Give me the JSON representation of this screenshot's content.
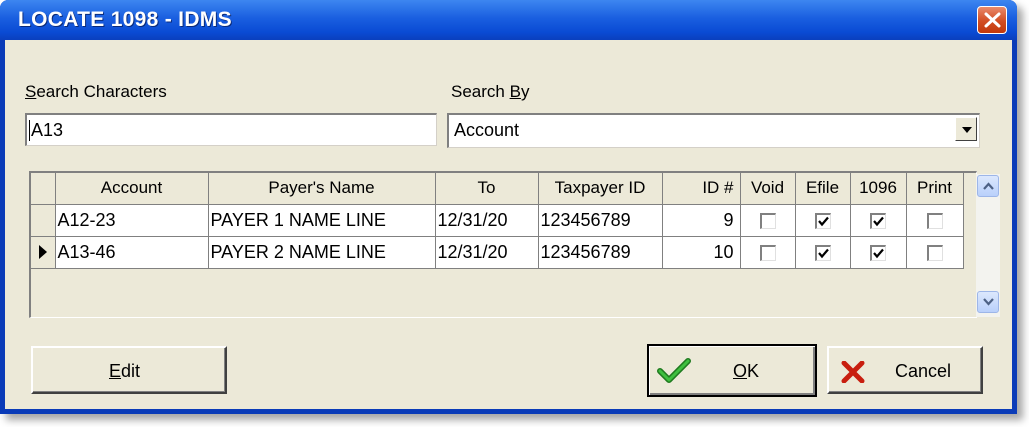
{
  "window": {
    "title": "LOCATE 1098 - IDMS"
  },
  "search": {
    "characters_label_key": "S",
    "characters_label_rest": "earch Characters",
    "characters_value": "A13",
    "by_label_prefix": "Search ",
    "by_label_key": "B",
    "by_label_rest": "y",
    "by_value": "Account"
  },
  "grid": {
    "columns": [
      "Account",
      "Payer's Name",
      "To",
      "Taxpayer ID",
      "ID #",
      "Void",
      "Efile",
      "1096",
      "Print"
    ],
    "rows": [
      {
        "account": "A12-23",
        "payer_name": "PAYER 1 NAME LINE",
        "to": "12/31/20",
        "taxpayer_id": "123456789",
        "id_num": "9",
        "void": false,
        "efile": true,
        "f1096": true,
        "print": false,
        "current": false
      },
      {
        "account": "A13-46",
        "payer_name": "PAYER 2 NAME LINE",
        "to": "12/31/20",
        "taxpayer_id": "123456789",
        "id_num": "10",
        "void": false,
        "efile": true,
        "f1096": true,
        "print": false,
        "current": true
      }
    ]
  },
  "buttons": {
    "edit_key": "E",
    "edit_rest": "dit",
    "ok_key": "O",
    "ok_rest": "K",
    "cancel": "Cancel"
  },
  "icons": {
    "ok": "checkmark-icon",
    "cancel": "red-x-icon",
    "close": "close-icon"
  },
  "colors": {
    "titlebar": "#0a4bd4",
    "dialog_bg": "#ece9d8",
    "ok_check": "#2fa82f",
    "cancel_x": "#c81e0f",
    "close_btn": "#d24d22"
  }
}
